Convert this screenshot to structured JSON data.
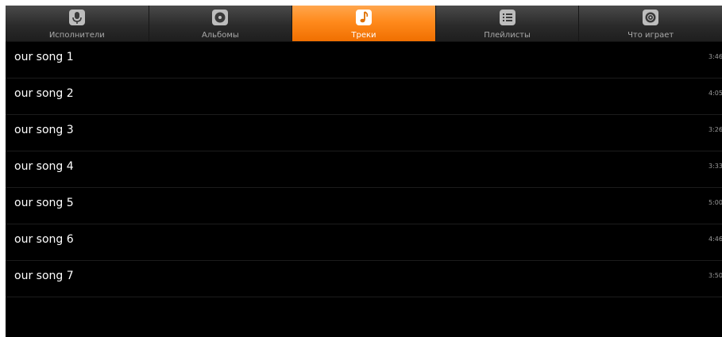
{
  "tabs": [
    {
      "label": "Исполнители",
      "icon": "microphone-icon",
      "active": false
    },
    {
      "label": "Альбомы",
      "icon": "album-disc-icon",
      "active": false
    },
    {
      "label": "Треки",
      "icon": "music-note-icon",
      "active": true
    },
    {
      "label": "Плейлисты",
      "icon": "playlist-icon",
      "active": false
    },
    {
      "label": "Что играет",
      "icon": "now-playing-icon",
      "active": false
    }
  ],
  "tracks": [
    {
      "title": "our song 1",
      "duration": "3:46"
    },
    {
      "title": "our song 2",
      "duration": "4:05"
    },
    {
      "title": "our song 3",
      "duration": "3:26"
    },
    {
      "title": "our song 4",
      "duration": "3:33"
    },
    {
      "title": "our song 5",
      "duration": "5:00"
    },
    {
      "title": "our song 6",
      "duration": "4:46"
    },
    {
      "title": "our song 7",
      "duration": "3:50"
    }
  ],
  "colors": {
    "accent": "#ff8a1c",
    "background": "#000000",
    "text": "#ffffff",
    "inactive_label": "#a9a9a9"
  }
}
